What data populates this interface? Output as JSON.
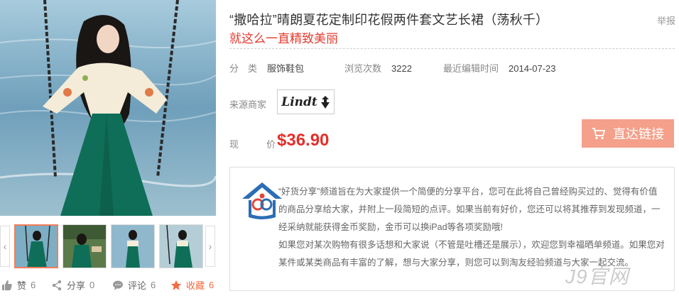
{
  "product": {
    "title": "“撒哈拉”晴朗夏花定制印花假两件套文艺长裙（荡秋千）",
    "subtitle": "就这么一直精致美丽",
    "report_label": "举报"
  },
  "meta": {
    "category_label": "分　类",
    "category_value": "服饰鞋包",
    "views_label": "浏览次数",
    "views_value": "3222",
    "edited_label": "最近编辑时间",
    "edited_value": "2014-07-23"
  },
  "source": {
    "label": "来源商家",
    "brand": "Lindt"
  },
  "price": {
    "label": "现　价",
    "value": "$36.90"
  },
  "buy_button": {
    "label": "直达链接",
    "icon": "cart-icon"
  },
  "info": {
    "paragraphs": [
      "“好货分享”频道旨在为大家提供一个简便的分享平台，您可在此将自己曾经购买过的、觉得有价值的商品分享给大家，并附上一段简短的点评。如果当前有好价，您还可以将其推荐到发现频道，一经采纳就能获得金币奖励，金币可以换iPad等各项奖励哦!",
      "如果您对某次购物有很多话想和大家说（不管是吐槽还是展示），欢迎您到幸福晒单频道。如果您对某件或某类商品有丰富的了解，想与大家分享，则您可以到淘友经验频道与大家一起交流。"
    ]
  },
  "social": {
    "like_label": "赞",
    "like_count": "6",
    "share_label": "分享",
    "share_count": "0",
    "comment_label": "评论",
    "comment_count": "6",
    "collect_label": "收藏",
    "collect_count": "6"
  },
  "thumbnails": {
    "prev": "‹",
    "next": "›"
  },
  "watermark": "J9官网",
  "colors": {
    "accent_red": "#e3302a",
    "button_salmon": "#f4a08a",
    "collect_orange": "#f36c3f"
  }
}
